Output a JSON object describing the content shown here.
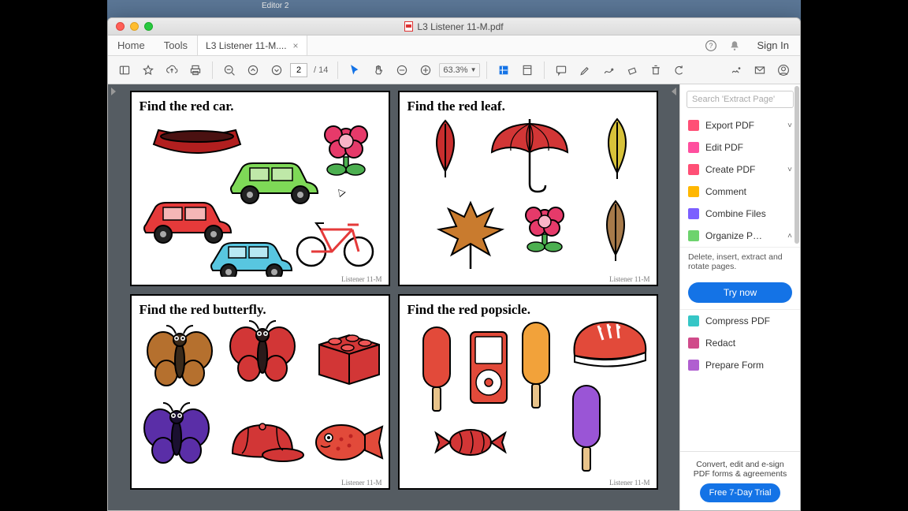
{
  "dock_hint": "Editor 2",
  "window_title": "L3 Listener 11-M.pdf",
  "nav": {
    "home": "Home",
    "tools": "Tools",
    "sign_in": "Sign In"
  },
  "tab": {
    "label": "L3 Listener 11-M....",
    "close": "×"
  },
  "toolbar": {
    "page_current": "2",
    "page_total": "/ 14",
    "zoom": "63.3%"
  },
  "cards": [
    {
      "prompt": "Find the red car.",
      "footer": "Listener 11-M"
    },
    {
      "prompt": "Find the red leaf.",
      "footer": "Listener 11-M"
    },
    {
      "prompt": "Find the red butterfly.",
      "footer": "Listener 11-M"
    },
    {
      "prompt": "Find the red popsicle.",
      "footer": "Listener 11-M"
    }
  ],
  "side": {
    "search_placeholder": "Search 'Extract Page'",
    "items": [
      {
        "label": "Export PDF",
        "color": "#ff4f76",
        "chev": true
      },
      {
        "label": "Edit PDF",
        "color": "#ff4f9e"
      },
      {
        "label": "Create PDF",
        "color": "#ff4f76",
        "chev": true
      },
      {
        "label": "Comment",
        "color": "#ffb700"
      },
      {
        "label": "Combine Files",
        "color": "#7b5fff"
      },
      {
        "label": "Organize P…",
        "color": "#6dd36d",
        "chev": true,
        "up": true
      }
    ],
    "organize_desc": "Delete, insert, extract and rotate pages.",
    "try_now": "Try now",
    "more": [
      {
        "label": "Compress PDF",
        "color": "#36c6c6"
      },
      {
        "label": "Redact",
        "color": "#d04a8a"
      },
      {
        "label": "Prepare Form",
        "color": "#b05fd0"
      }
    ],
    "promo_line": "Convert, edit and e-sign PDF forms & agreements",
    "trial": "Free 7-Day Trial"
  }
}
